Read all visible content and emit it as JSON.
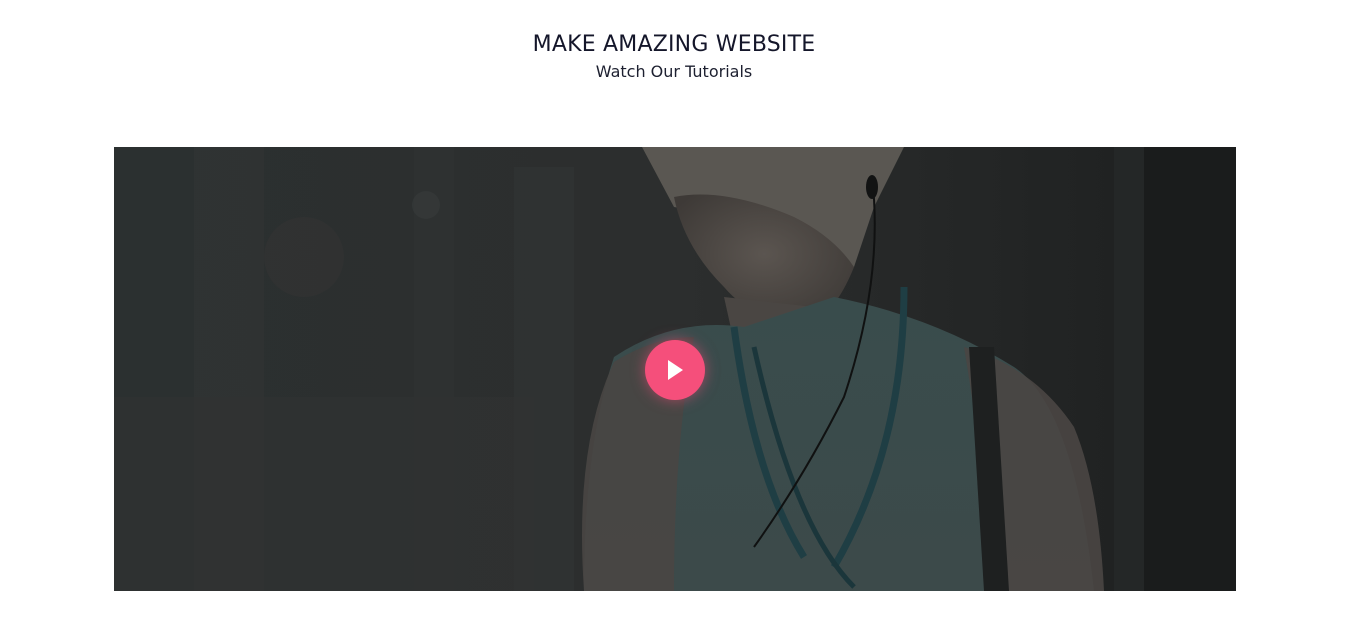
{
  "section": {
    "title": "MAKE AMAZING WEBSITE",
    "subtitle": "Watch Our Tutorials"
  },
  "video": {
    "play_icon": "play-icon",
    "accent_color": "#f54f7b",
    "overlay_color": "#2a2b2c"
  }
}
